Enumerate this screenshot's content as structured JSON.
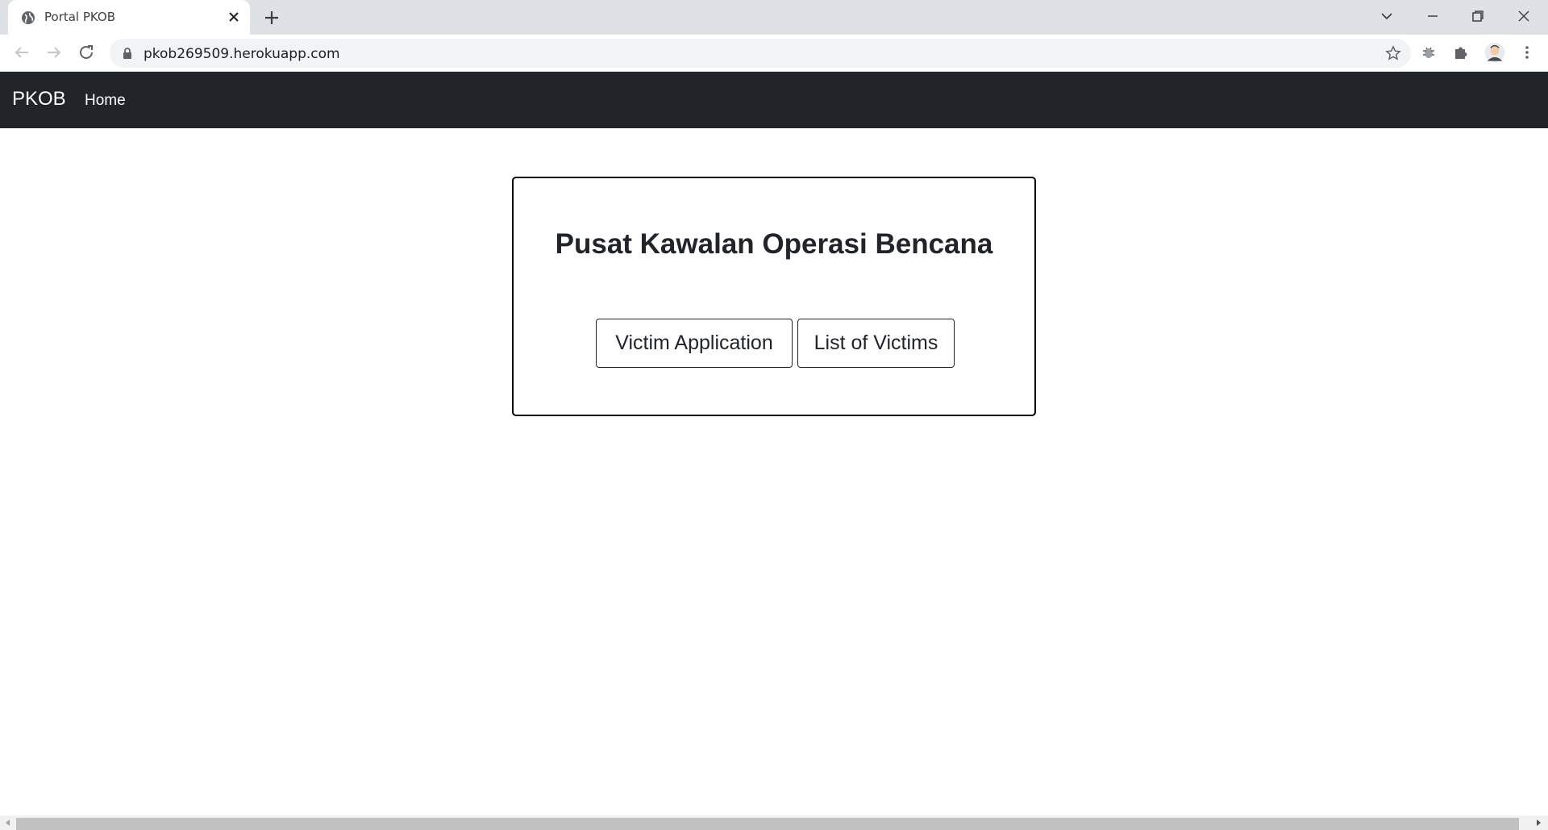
{
  "browser": {
    "tab_title": "Portal PKOB",
    "url": "pkob269509.herokuapp.com"
  },
  "navbar": {
    "brand": "PKOB",
    "home_label": "Home",
    "bg_color": "#212529"
  },
  "card": {
    "title": "Pusat Kawalan Operasi Bencana",
    "buttons": [
      "Victim Application",
      "List of Victims"
    ]
  }
}
